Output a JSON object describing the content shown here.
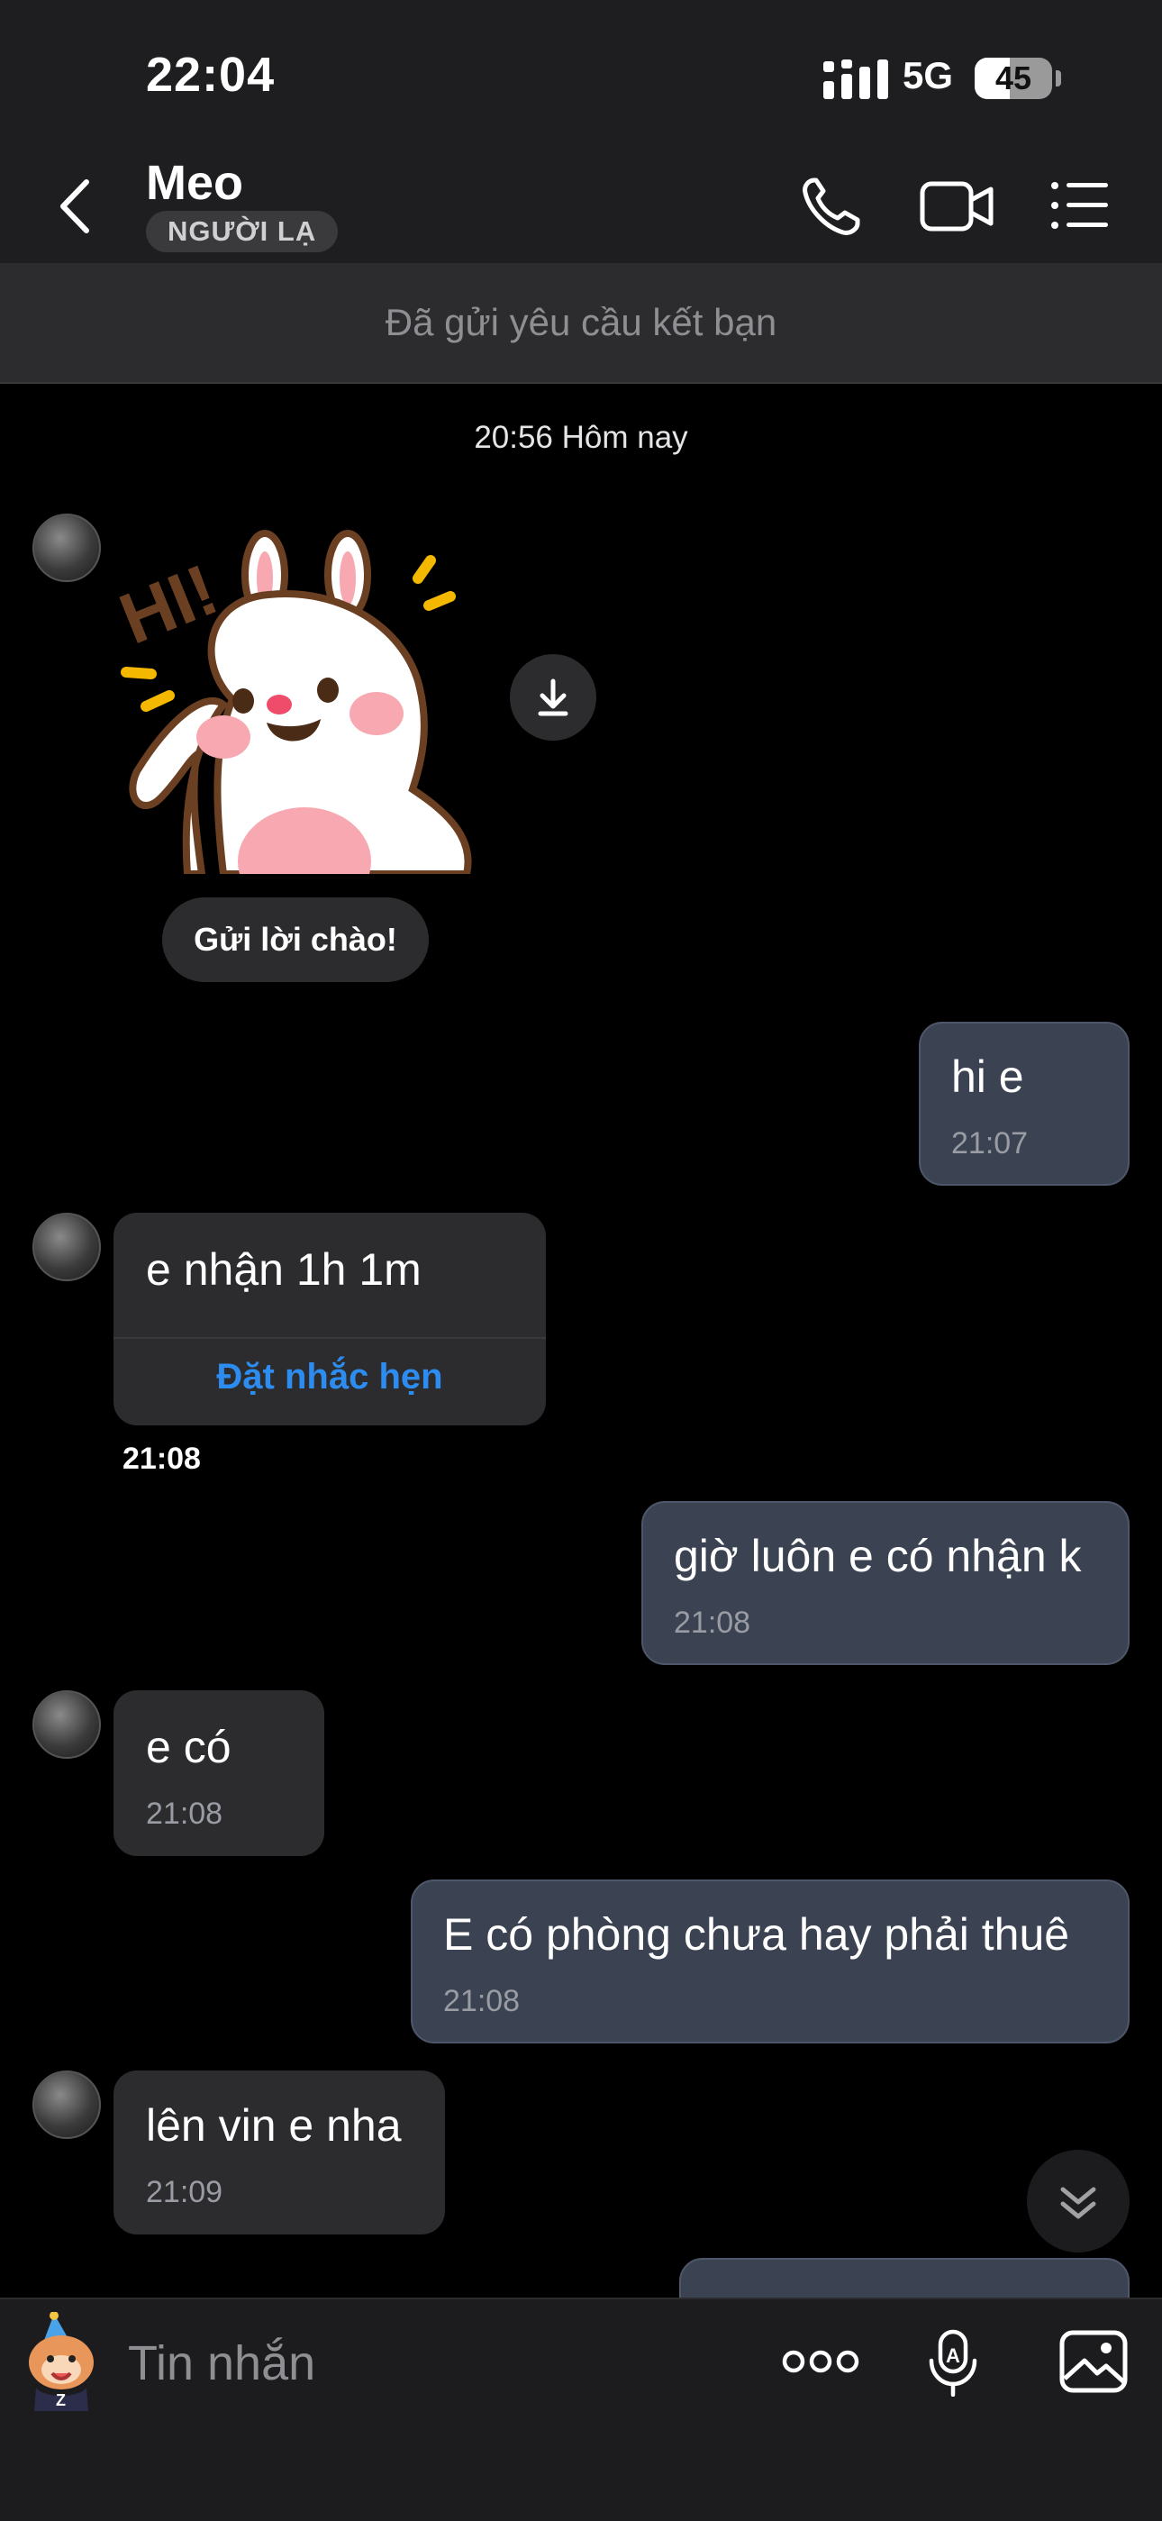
{
  "status_bar": {
    "time": "22:04",
    "network": "5G",
    "battery_level": "45",
    "battery_fraction": 0.45
  },
  "header": {
    "name": "Meo",
    "badge": "NGƯỜI LẠ"
  },
  "friend_request": {
    "text": "Đã gửi yêu cầu kết bạn"
  },
  "day_label": "20:56 Hôm nay",
  "sticker": {
    "text": "HI!",
    "greet_button": "Gửi lời chào!"
  },
  "messages": [
    {
      "dir": "out",
      "text": "hi e",
      "time": "21:07"
    },
    {
      "dir": "in",
      "text": "e nhận 1h 1m",
      "action": "Đặt nhắc hẹn",
      "time": "21:08"
    },
    {
      "dir": "out",
      "text": "giờ luôn e có nhận k",
      "time": "21:08"
    },
    {
      "dir": "in",
      "text": "e có",
      "time": "21:08"
    },
    {
      "dir": "out",
      "text": "E có phòng chưa hay phải thuê",
      "time": "21:08"
    },
    {
      "dir": "in",
      "text": "lên vin e nha",
      "time": "21:09"
    }
  ],
  "composer": {
    "placeholder": "Tin nhắn"
  },
  "colors": {
    "accent": "#2d8cf0",
    "outgoing_bubble": "#3b4353",
    "incoming_bubble": "#2c2c2e"
  }
}
